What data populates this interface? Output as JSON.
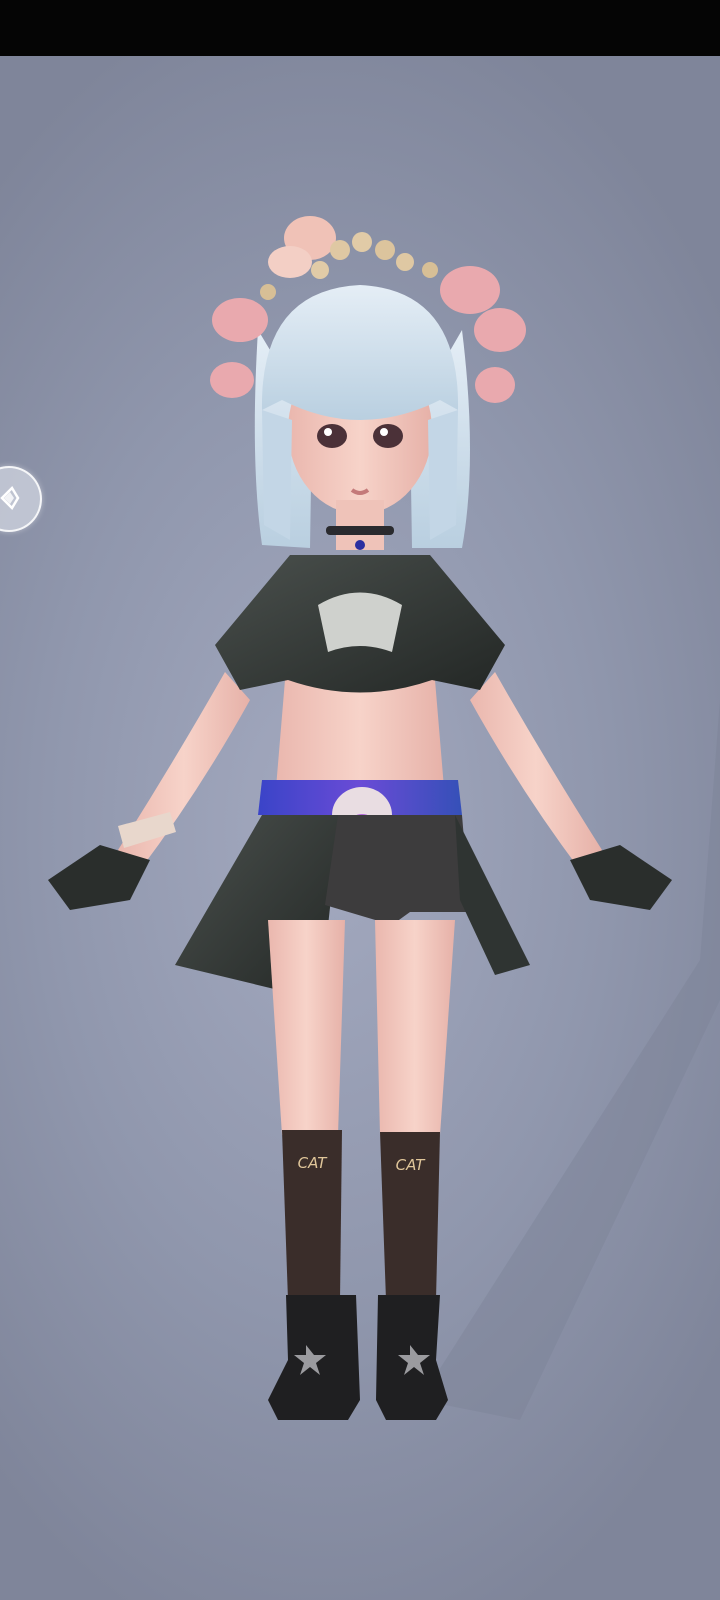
{
  "screen": {
    "background_color": "#9aa0b6",
    "topbar_color": "#050505"
  },
  "side_panel_toggle": {
    "icon": "diamond-chevron-right-icon"
  },
  "character": {
    "sock_text_left": "CAT",
    "sock_text_right": "CAT",
    "colors": {
      "hair": "#c7d9e8",
      "skin": "#f3c9bf",
      "outfit": "#2f3432",
      "belt": "#4c4cc8",
      "socks": "#3a2d2a",
      "boots": "#1f1f21",
      "flowers": "#e9a9ae"
    }
  }
}
